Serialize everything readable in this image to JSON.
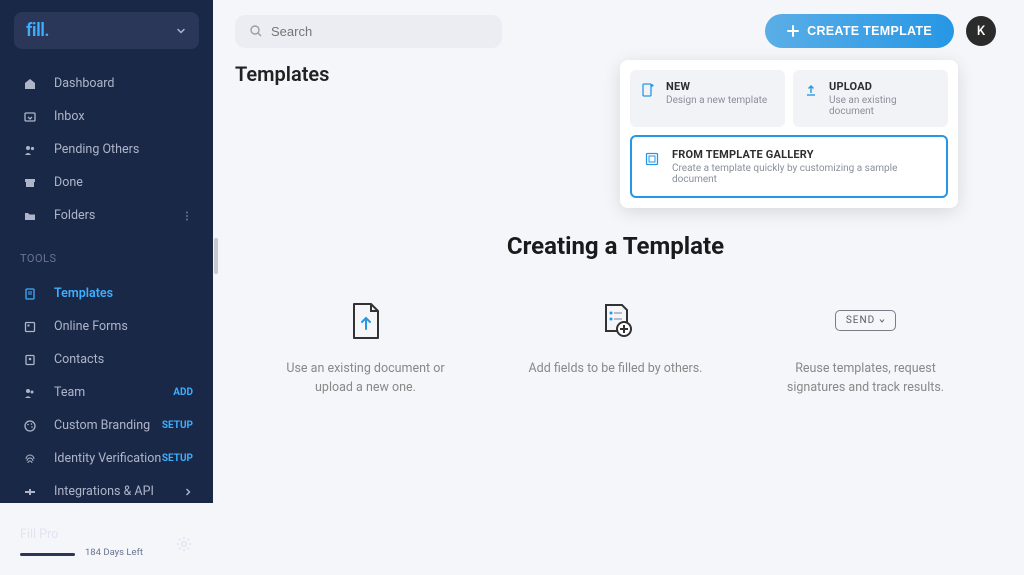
{
  "brand": {
    "logo_text": "fill."
  },
  "sidebar": {
    "nav": [
      {
        "label": "Dashboard"
      },
      {
        "label": "Inbox"
      },
      {
        "label": "Pending Others"
      },
      {
        "label": "Done"
      },
      {
        "label": "Folders"
      }
    ],
    "tools_heading": "TOOLS",
    "tools": [
      {
        "label": "Templates",
        "active": true
      },
      {
        "label": "Online Forms"
      },
      {
        "label": "Contacts"
      },
      {
        "label": "Team",
        "right": "ADD"
      },
      {
        "label": "Custom Branding",
        "right": "SETUP"
      },
      {
        "label": "Identity Verification",
        "right": "SETUP"
      },
      {
        "label": "Integrations & API"
      }
    ],
    "plan": {
      "name": "Fill Pro",
      "days_left": "184 Days Left"
    }
  },
  "topbar": {
    "search_placeholder": "Search",
    "create_label": "CREATE TEMPLATE",
    "avatar_initial": "K"
  },
  "page": {
    "title": "Templates"
  },
  "dropdown": {
    "new": {
      "title": "NEW",
      "sub": "Design a new template"
    },
    "upload": {
      "title": "UPLOAD",
      "sub": "Use an existing document"
    },
    "gallery": {
      "title": "FROM TEMPLATE GALLERY",
      "sub": "Create a template quickly by customizing a sample document"
    }
  },
  "center": {
    "heading": "Creating a Template",
    "steps": [
      {
        "text": "Use an existing document or upload a new one."
      },
      {
        "text": "Add fields to be filled by others."
      },
      {
        "text": "Reuse templates, request signatures and track results.",
        "send_label": "SEND"
      }
    ]
  }
}
